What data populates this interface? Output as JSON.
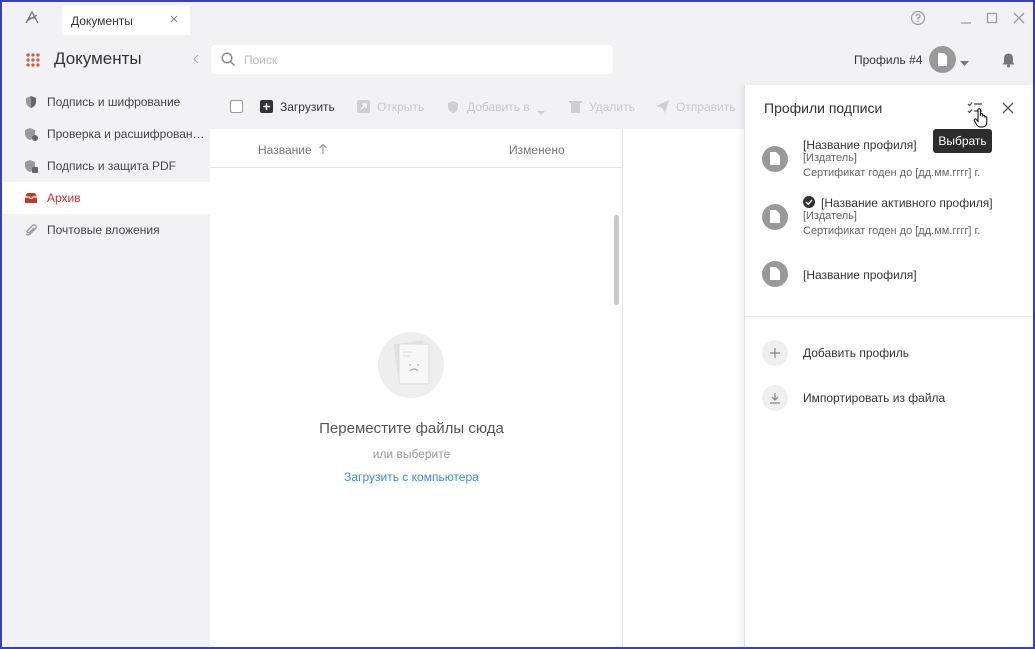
{
  "titlebar": {
    "tab_label": "Документы"
  },
  "header": {
    "title": "Документы",
    "search_placeholder": "Поиск",
    "search_value": "",
    "profile_label": "Профиль #4"
  },
  "sidebar": {
    "items": [
      {
        "label": "Подпись и шифрование",
        "icon": "shield-icon"
      },
      {
        "label": "Проверка и расшифрован…",
        "icon": "shield-check-icon"
      },
      {
        "label": "Подпись и защита PDF",
        "icon": "pdf-shield-icon"
      },
      {
        "label": "Архив",
        "icon": "archive-icon",
        "active": true
      },
      {
        "label": "Почтовые вложения",
        "icon": "paperclip-icon"
      }
    ]
  },
  "toolbar": {
    "upload": "Загрузить",
    "open": "Открыть",
    "add_to": "Добавить в",
    "delete": "Удалить",
    "send": "Отправить"
  },
  "table": {
    "col_name": "Название",
    "col_modified": "Изменено"
  },
  "empty_state": {
    "title": "Переместите файлы сюда",
    "subtitle": "или выберите",
    "link": "Загрузить с компьютера"
  },
  "panel": {
    "title": "Профили подписи",
    "tooltip": "Выбрать",
    "profiles": [
      {
        "name": "[Название профиля]",
        "issuer": "[Издатель]",
        "cert": "Сертификат годен до [дд.мм.гггг] г."
      },
      {
        "name": "[Название активного профиля]",
        "issuer": "[Издатель]",
        "cert": "Сертификат годен до [дд.мм.гггг] г.",
        "active": true
      },
      {
        "name": "[Название профиля]"
      }
    ],
    "actions": {
      "add": "Добавить профиль",
      "import": "Импортировать из файла"
    }
  },
  "colors": {
    "accent": "#c0392b",
    "link": "#3b8fd6",
    "window_border": "#3b3fb8"
  }
}
